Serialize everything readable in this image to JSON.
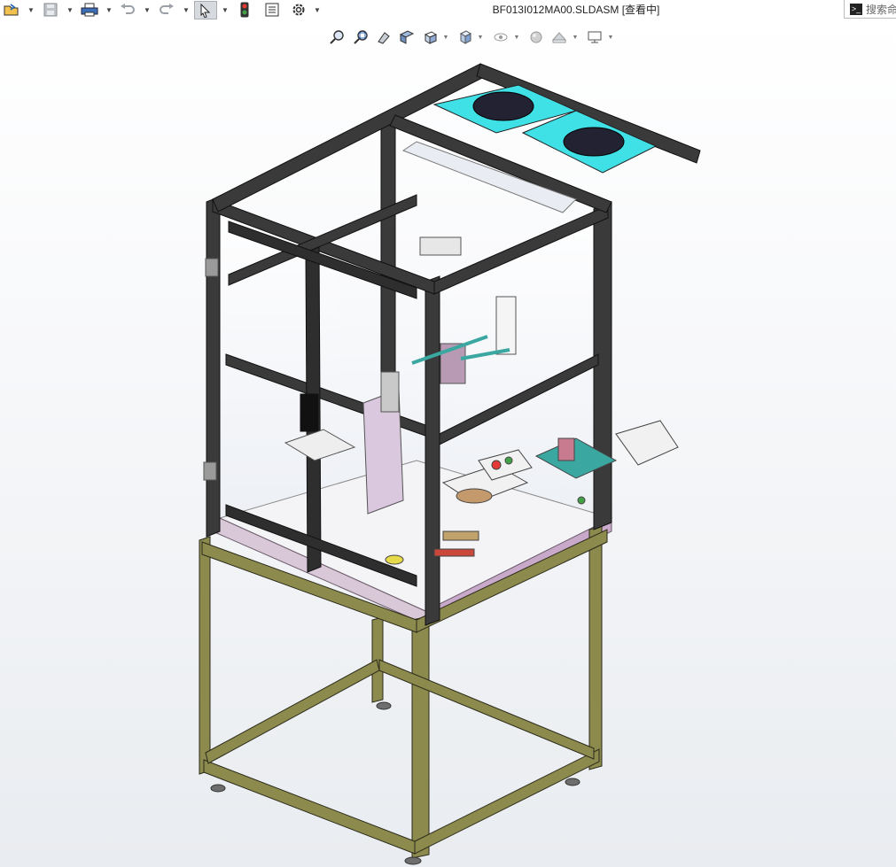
{
  "window": {
    "document_title": "BF013I012MA00.SLDASM [查看中]",
    "search_placeholder": "搜索命"
  },
  "toolbar": {
    "items": [
      {
        "name": "open-icon",
        "label": ""
      },
      {
        "name": "save-icon",
        "label": ""
      },
      {
        "name": "print-icon",
        "label": ""
      },
      {
        "name": "undo-icon",
        "label": ""
      },
      {
        "name": "redo-icon",
        "label": ""
      },
      {
        "name": "select-icon",
        "label": ""
      },
      {
        "name": "rebuild-traffic-light-icon",
        "label": ""
      },
      {
        "name": "file-properties-icon",
        "label": ""
      },
      {
        "name": "options-gear-icon",
        "label": ""
      }
    ]
  },
  "heads_up_toolbar": {
    "items": [
      {
        "name": "zoom-to-fit-icon"
      },
      {
        "name": "zoom-to-area-icon"
      },
      {
        "name": "previous-view-icon"
      },
      {
        "name": "section-view-icon"
      },
      {
        "name": "view-orientation-icon"
      },
      {
        "name": "display-style-icon"
      },
      {
        "name": "hide-show-items-icon"
      },
      {
        "name": "edit-appearance-icon"
      },
      {
        "name": "apply-scene-icon"
      },
      {
        "name": "view-settings-icon"
      }
    ]
  },
  "colors": {
    "frame_upper": "#2b2b2b",
    "frame_lower": "#6b6b3a",
    "fan_panel": "#3fe0e6",
    "panel_glass": "#eef1f7",
    "accent_teal": "#3aa7a0"
  }
}
